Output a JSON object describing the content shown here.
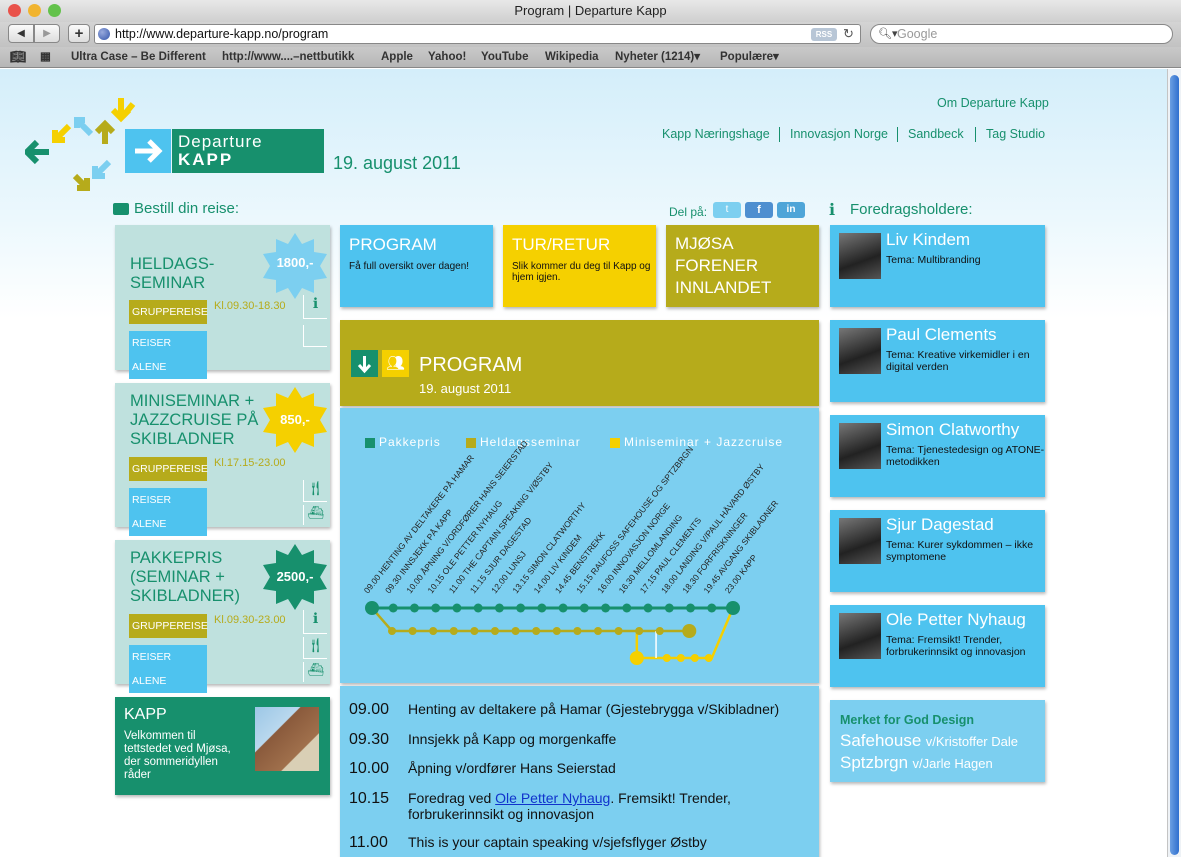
{
  "browser": {
    "window_title": "Program | Departure Kapp",
    "url": "http://www.departure-kapp.no/program",
    "search_placeholder": "Google",
    "rss": "RSS",
    "bookmarks": [
      "Ultra Case – Be Different",
      "http://www....–nettbutikk",
      "Apple",
      "Yahoo!",
      "YouTube",
      "Wikipedia",
      "Nyheter (1214)",
      "Populære"
    ]
  },
  "header": {
    "logo_line1": "Departure",
    "logo_line2": "KAPP",
    "date": "19. august 2011",
    "about_link": "Om Departure Kapp",
    "partners": [
      "Kapp Næringshage",
      "Innovasjon Norge",
      "Sandbeck",
      "Tag Studio"
    ]
  },
  "booking": {
    "heading": "Bestill din reise:",
    "cards": [
      {
        "title_1": "HELDAGS-",
        "title_2": "SEMINAR",
        "title_3": "",
        "price": "1800,-",
        "time": "Kl.09.30-18.30",
        "group": "GRUPPEREISE",
        "alone": "REISER ALENE"
      },
      {
        "title_1": "MINISEMINAR +",
        "title_2": "JAZZCRUISE PÅ",
        "title_3": "SKIBLADNER",
        "price": "850,-",
        "time": "Kl.17.15-23.00",
        "group": "GRUPPEREISE",
        "alone": "REISER ALENE"
      },
      {
        "title_1": "PAKKEPRIS",
        "title_2": "(SEMINAR +",
        "title_3": "SKIBLADNER)",
        "price": "2500,-",
        "time": "Kl.09.30-23.00",
        "group": "GRUPPEREISE",
        "alone": "REISER ALENE"
      }
    ],
    "kapp": {
      "title": "KAPP",
      "text": "Velkommen til tettstedet ved Mjøsa, der sommeridyllen råder"
    }
  },
  "share": {
    "label": "Del på:"
  },
  "tiles": [
    {
      "title": "PROGRAM",
      "text": "Få full oversikt over dagen!"
    },
    {
      "title": "TUR/RETUR",
      "text": "Slik kommer du deg til Kapp og hjem igjen."
    },
    {
      "title": "MJØSA FORENER INNLANDET",
      "text": ""
    }
  ],
  "program": {
    "title": "PROGRAM",
    "date": "19. august 2011",
    "legend": [
      "Pakkepris",
      "Heldagsseminar",
      "Miniseminar + Jazzcruise"
    ],
    "legend_colors": [
      "#17906d",
      "#b6ab1b",
      "#f5d000"
    ],
    "timeline_labels": [
      "09.00 HENTING AV DELTAKERE PÅ HAMAR",
      "09.30 INNSJEKK PÅ KAPP",
      "10.00 ÅPNING V/ORDFØRER HANS SEIERSTAD",
      "10.15 OLE PETTER NYHAUG",
      "11.00 THE CAPTAIN SPEAKING V/ØSTBY",
      "11.15 SJUR DAGESTAD",
      "12.00 LUNSJ",
      "13.15 SIMON CLATWORTHY",
      "14.00 LIV KINDEM",
      "14.45 BENSTREKK",
      "15.15 RAUFOSS SAFEHOUSE OG SPTZBRGN",
      "16.00 INNOVASJON NORGE",
      "16.30 MELLOMLANDING",
      "17.15 PAUL CLEMENTS",
      "18.00 LANDING V/PAUL HÅVARD ØSTBY",
      "18.30 FORFRISKNINGER",
      "19.45 AVGANG SKIBLADNER",
      "23.00 KAPP"
    ],
    "items": [
      {
        "time": "09.00",
        "pre": "Henting av deltakere på Hamar (Gjestebrygga v/Skibladner)",
        "link": "",
        "post": ""
      },
      {
        "time": "09.30",
        "pre": "Innsjekk på Kapp og morgenkaffe",
        "link": "",
        "post": ""
      },
      {
        "time": "10.00",
        "pre": "Åpning v/ordfører Hans Seierstad",
        "link": "",
        "post": ""
      },
      {
        "time": "10.15",
        "pre": "Foredrag ved ",
        "link": "Ole Petter Nyhaug",
        "post": ". Fremsikt! Trender, forbrukerinnsikt og innovasjon"
      },
      {
        "time": "11.00",
        "pre": "This is your captain speaking v/sjefsflyger Østby",
        "link": "",
        "post": ""
      }
    ]
  },
  "speakers": {
    "heading": "Foredragsholdere:",
    "list": [
      {
        "name": "Liv Kindem",
        "topic": "Tema: Multibranding"
      },
      {
        "name": "Paul Clements",
        "topic": "Tema: Kreative virkemidler i en digital verden"
      },
      {
        "name": "Simon Clatworthy",
        "topic": "Tema: Tjenestedesign og ATONE-metodikken"
      },
      {
        "name": "Sjur Dagestad",
        "topic": "Tema: Kurer sykdommen – ikke symptomene"
      },
      {
        "name": "Ole Petter Nyhaug",
        "topic": "Tema: Fremsikt! Trender, forbrukerinnsikt og innovasjon"
      }
    ],
    "market": {
      "title": "Merket for God Design",
      "brand1": "Safehouse",
      "by1": "v/Kristoffer Dale",
      "brand2": "Sptzbrgn",
      "by2": "v/Jarle Hagen"
    }
  }
}
